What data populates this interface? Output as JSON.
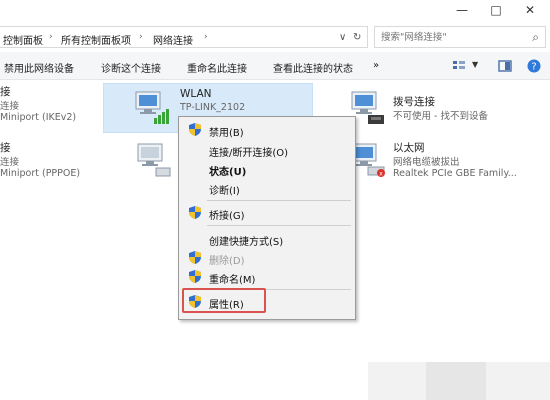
{
  "window": {
    "minimize_glyph": "—",
    "maximize_glyph": "□",
    "close_glyph": "✕"
  },
  "address": {
    "crumbs": [
      "控制面板",
      "所有控制面板项",
      "网络连接"
    ],
    "sep": "›",
    "dropdown_glyph": "∨",
    "refresh_glyph": "↻",
    "search_placeholder": "搜索\"网络连接\"",
    "search_glyph": "⌕"
  },
  "toolbar": {
    "disable": "禁用此网络设备",
    "diagnose": "诊断这个连接",
    "rename": "重命名此连接",
    "status": "查看此连接的状态",
    "more": "»"
  },
  "connections": {
    "left1": {
      "name": "接",
      "sub1": "连接",
      "sub2": "Miniport (IKEv2)"
    },
    "left2": {
      "name": "接",
      "sub1": "连接",
      "sub2": "Miniport (PPPOE)"
    },
    "wlan": {
      "name": "WLAN",
      "sub": "TP-LINK_2102"
    },
    "dialup": {
      "name": "拨号连接",
      "sub": "不可使用 - 找不到设备"
    },
    "ethernet": {
      "name": "以太网",
      "sub1": "网络电缆被拔出",
      "sub2": "Realtek PCIe GBE Family..."
    }
  },
  "context_menu": {
    "disable": "禁用(B)",
    "connect": "连接/断开连接(O)",
    "status": "状态(U)",
    "diagnose": "诊断(I)",
    "bridge": "桥接(G)",
    "shortcut": "创建快捷方式(S)",
    "delete": "删除(D)",
    "rename": "重命名(M)",
    "properties": "属性(R)"
  },
  "colors": {
    "selection": "#d8eaf9",
    "highlight": "#d9534f",
    "shield_blue": "#2f6fd1",
    "shield_yellow": "#f2c12e"
  }
}
